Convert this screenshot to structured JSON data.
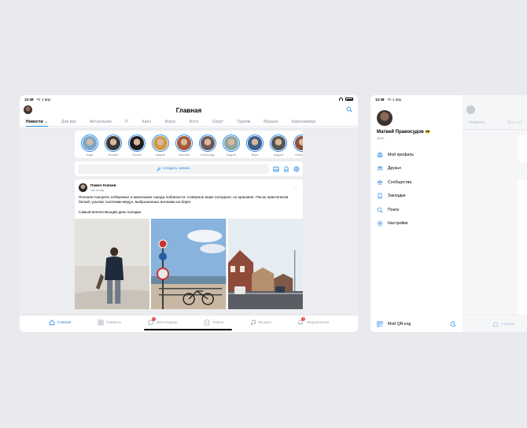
{
  "tablet1": {
    "status": {
      "time": "12:48",
      "date": "Чт 1 апр."
    },
    "header": {
      "title": "Главная"
    },
    "tabs": [
      "Новости",
      "Для вас",
      "Актуальное",
      "IT",
      "Кино",
      "Фокус",
      "Фото",
      "Спорт",
      "Туризм",
      "Музыка",
      "Коронавирус"
    ],
    "stories": [
      {
        "name": "Надя",
        "color": "#7aa7c7"
      },
      {
        "name": "Михаил",
        "color": "#3a3a3a"
      },
      {
        "name": "Руслан",
        "color": "#1d1d22"
      },
      {
        "name": "Андрей",
        "color": "#d19a4a"
      },
      {
        "name": "Евгений",
        "color": "#a35b3a"
      },
      {
        "name": "Александр",
        "color": "#6b5a55"
      },
      {
        "name": "Андрей",
        "color": "#8aa6a0"
      },
      {
        "name": "Вера",
        "color": "#3c5f8a"
      },
      {
        "name": "Андрей",
        "color": "#555555"
      },
      {
        "name": "Александр",
        "color": "#8a4f3a"
      }
    ],
    "composer": {
      "label": "Создать запись"
    },
    "post": {
      "author": "Павел Князев",
      "time": "час назад",
      "paragraphs": [
        "Поехали покорять побережье и маленькие города поблизости. Северное море холодное, но красивое. Песок практически белый, усыпан тысячами медуз, выброшенных волнами на берег.",
        "Самый впечатляющий день поездки."
      ]
    },
    "nav": [
      {
        "label": "Главная",
        "icon": "home-icon",
        "active": true
      },
      {
        "label": "Сервисы",
        "icon": "services-icon"
      },
      {
        "label": "Мессенджер",
        "icon": "messenger-icon",
        "badge": "3"
      },
      {
        "label": "Клипы",
        "icon": "clips-icon"
      },
      {
        "label": "Музыка",
        "icon": "music-icon"
      },
      {
        "label": "Уведомления",
        "icon": "bell-icon",
        "badge": "5"
      }
    ],
    "accent": "#2688eb"
  },
  "tablet2": {
    "status": {
      "time": "12:48",
      "date": "Чт 1 апр."
    },
    "profile": {
      "name": "Матвей Правосудов",
      "emoji": "😎",
      "handle": "@id0"
    },
    "menu": [
      {
        "label": "Мой профиль",
        "icon": "profile-icon"
      },
      {
        "label": "Друзья",
        "icon": "friends-icon"
      },
      {
        "label": "Сообщества",
        "icon": "communities-icon"
      },
      {
        "label": "Закладки",
        "icon": "bookmark-icon"
      },
      {
        "label": "Поиск",
        "icon": "search-icon"
      },
      {
        "label": "Настройки",
        "icon": "settings-icon"
      }
    ],
    "footer": {
      "qr_label": "Мой QR-код"
    },
    "behind": {
      "tab1": "Новости",
      "tab2": "Для вас",
      "nav_home": "Главная"
    }
  }
}
